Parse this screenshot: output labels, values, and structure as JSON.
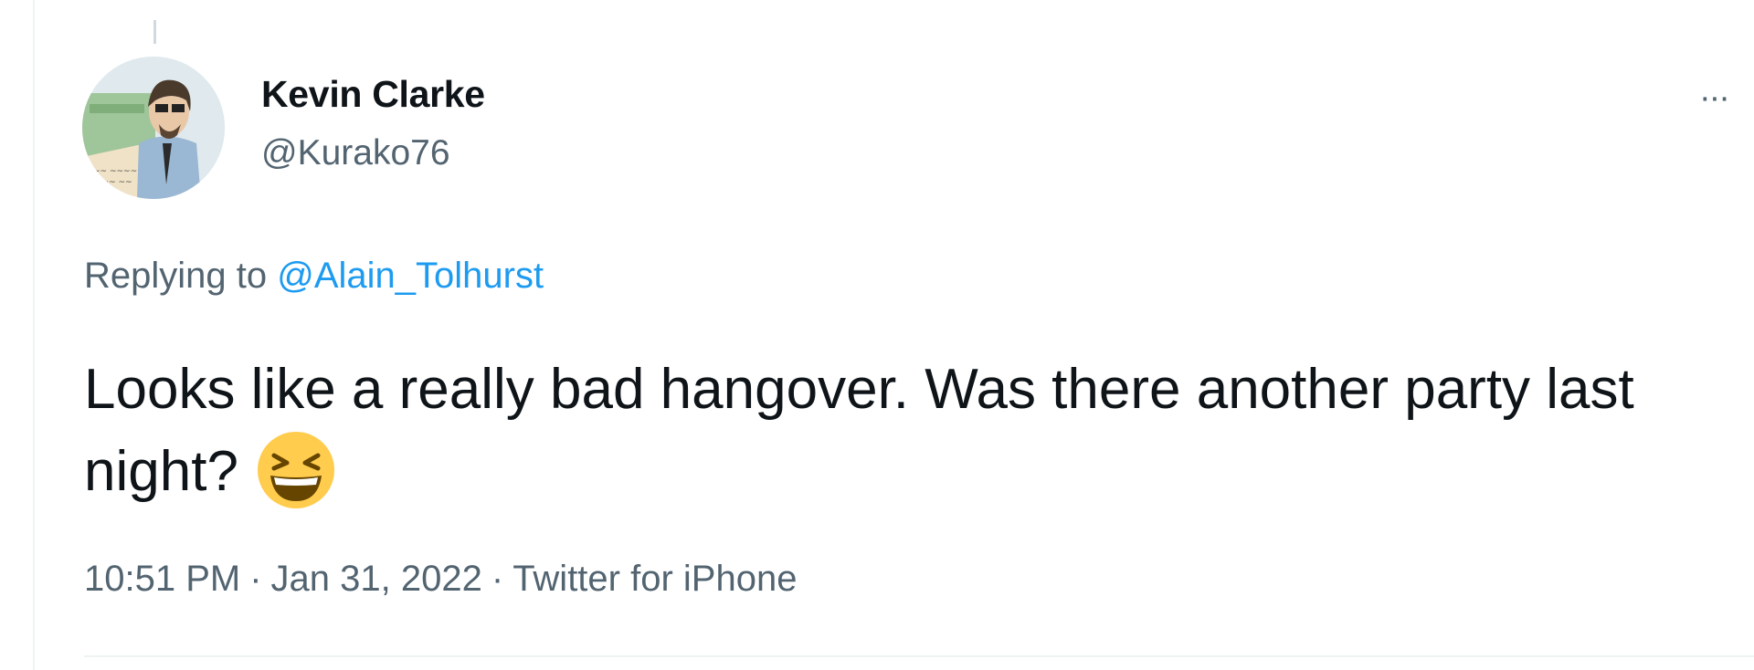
{
  "tweet": {
    "author": {
      "display_name": "Kevin Clarke",
      "handle": "@Kurako76",
      "avatar_icon": "comic-illustration-avatar"
    },
    "more_icon": "ellipsis-icon",
    "more_label": "···",
    "reply_prefix": "Replying to",
    "reply_to": "@Alain_Tolhurst",
    "text": "Looks like a really bad hangover. Was there another party last night?",
    "emoji": "grinning-squinting-face-emoji",
    "time": "10:51 PM",
    "date": "Jan 31, 2022",
    "source": "Twitter for iPhone",
    "separator": "·"
  },
  "colors": {
    "text_primary": "#0f1419",
    "text_secondary": "#536471",
    "link": "#1d9bf0",
    "border": "#eff3f4"
  }
}
